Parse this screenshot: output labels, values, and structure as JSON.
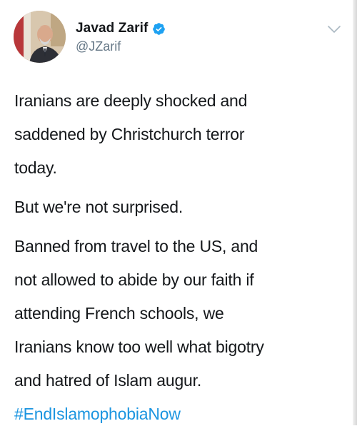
{
  "author": {
    "display_name": "Javad Zarif",
    "handle": "@JZarif",
    "verified": true
  },
  "icons": {
    "verified": "verified-badge-icon",
    "menu": "chevron-down-icon",
    "avatar": "profile-photo"
  },
  "tweet": {
    "paragraphs": [
      {
        "lines": [
          "Iranians are deeply shocked and",
          "saddened by Christchurch terror",
          "today."
        ]
      },
      {
        "lines": [
          "But we're not surprised."
        ]
      },
      {
        "lines": [
          "Banned from travel to the US, and",
          "not allowed to abide by our faith if",
          "attending French schools, we",
          "Iranians know too well what bigotry",
          "and hatred of Islam augur."
        ]
      }
    ],
    "hashtag": "#EndIslamophobiaNow"
  },
  "colors": {
    "text": "#14171a",
    "secondary": "#657786",
    "link": "#1b95e0",
    "verified": "#1da1f2"
  }
}
